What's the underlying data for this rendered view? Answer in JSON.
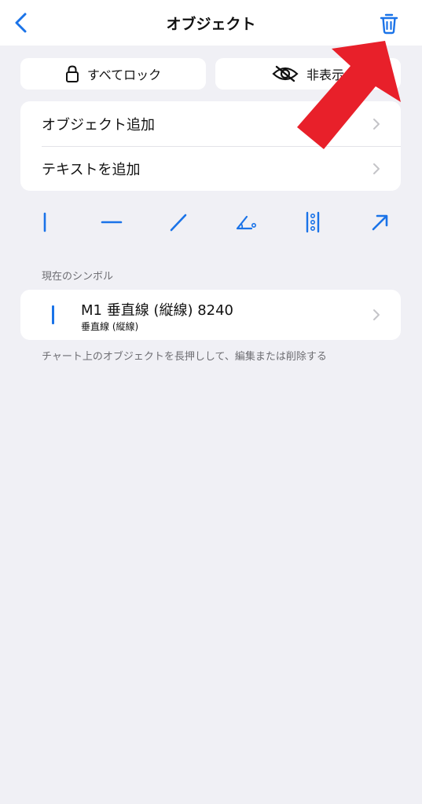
{
  "nav": {
    "title": "オブジェクト",
    "back_icon": "chevron-left-icon",
    "trash_icon": "trash-icon"
  },
  "actions": {
    "lock_all": "すべてロック",
    "hide": "非表示"
  },
  "menu": {
    "items": [
      {
        "label": "オブジェクト追加"
      },
      {
        "label": "テキストを追加"
      }
    ]
  },
  "tools": [
    "vertical-line-icon",
    "horizontal-line-icon",
    "trend-line-icon",
    "angle-icon",
    "dotted-vertical-icon",
    "arrow-icon"
  ],
  "current_symbols": {
    "header": "現在のシンボル",
    "items": [
      {
        "title": "M1 垂直線 (縦線) 8240",
        "subtitle": "垂直線 (縦線)"
      }
    ]
  },
  "footer_note": "チャート上のオブジェクトを長押しして、編集または削除する",
  "colors": {
    "accent": "#1a73e8",
    "annotation_arrow": "#e8202a",
    "background": "#f0f0f5"
  }
}
